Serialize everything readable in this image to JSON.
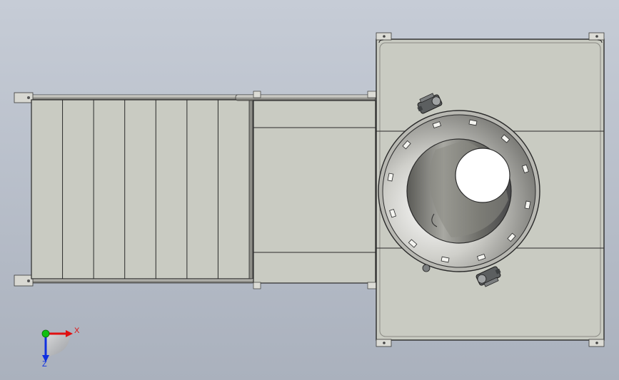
{
  "viewport": {
    "background_top": "#c6ccd6",
    "background_bottom": "#aab1bd"
  },
  "model": {
    "panel_fill": "#c9cbc2",
    "edge_color": "#2a2a2a",
    "metal_light": "#e2e2dc",
    "metal_dark": "#6a6a66",
    "motor_color": "#5c5f60",
    "conveyor_slats": 7
  },
  "triad": {
    "x_label": "X",
    "z_label": "Z",
    "x_color": "#e01010",
    "y_color": "#10c010",
    "z_color": "#1030e0"
  }
}
